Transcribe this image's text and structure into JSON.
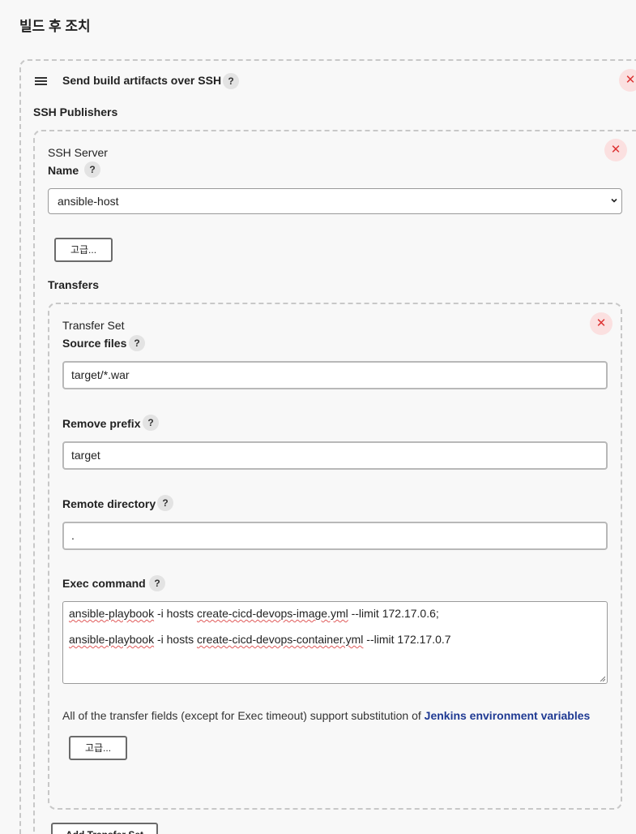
{
  "section": {
    "title": "빌드 후 조치"
  },
  "step": {
    "title": "Send build artifacts over SSH",
    "help": "?",
    "close": "✕"
  },
  "publishers": {
    "label": "SSH Publishers"
  },
  "server": {
    "heading": "SSH Server",
    "name_label": "Name",
    "name_help": "?",
    "name_value": "ansible-host",
    "close": "✕",
    "advanced_label": "고급..."
  },
  "transfers": {
    "label": "Transfers"
  },
  "transfer_set": {
    "heading": "Transfer Set",
    "close": "✕",
    "source_files": {
      "label": "Source files",
      "help": "?",
      "value": "target/*.war"
    },
    "remove_prefix": {
      "label": "Remove prefix",
      "help": "?",
      "value": "target"
    },
    "remote_directory": {
      "label": "Remote directory",
      "help": "?",
      "value": "."
    },
    "exec_command": {
      "label": "Exec command",
      "help": "?",
      "line1": {
        "p1": "ansible-playbook",
        "p2": " -i hosts ",
        "p3": "create-cicd-devops-image.yml",
        "p4": " --limit 172.17.0.6;"
      },
      "line2": {
        "p1": "ansible-playbook",
        "p2": " -i hosts ",
        "p3": "create-cicd-devops-container.yml",
        "p4": " --limit 172.17.0.7"
      }
    },
    "note_text": "All of the transfer fields (except for Exec timeout) support substitution of ",
    "note_link": "Jenkins environment variables",
    "advanced_label": "고급..."
  },
  "add_transfer_set_label": "Add Transfer Set"
}
